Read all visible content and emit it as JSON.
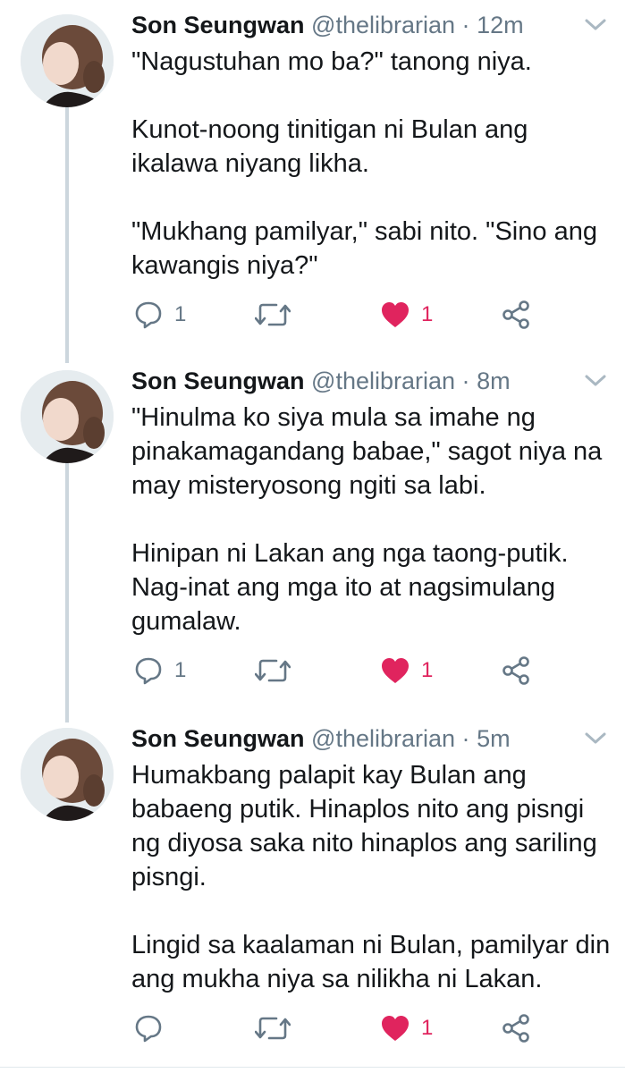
{
  "thread": [
    {
      "author_name": "Son Seungwan",
      "handle": "@thelibrarian",
      "separator": "·",
      "time": "12m",
      "paragraphs": [
        "\"Nagustuhan mo ba?\" tanong niya.",
        "Kunot-noong tinitigan ni Bulan ang ikalawa niyang likha.",
        "\"Mukhang pamilyar,\" sabi nito. \"Sino ang kawangis niya?\""
      ],
      "reply_count": "1",
      "retweet_count": "",
      "like_count": "1",
      "liked": true
    },
    {
      "author_name": "Son Seungwan",
      "handle": "@thelibrarian",
      "separator": "·",
      "time": "8m",
      "paragraphs": [
        "\"Hinulma ko siya mula sa imahe ng pinakamagandang babae,\" sagot niya na may misteryosong ngiti sa labi.",
        "Hinipan ni Lakan ang nga taong-putik. Nag-inat ang mga ito at nagsimulang gumalaw."
      ],
      "reply_count": "1",
      "retweet_count": "",
      "like_count": "1",
      "liked": true
    },
    {
      "author_name": "Son Seungwan",
      "handle": "@thelibrarian",
      "separator": "·",
      "time": "5m",
      "paragraphs": [
        "Humakbang palapit kay Bulan ang babaeng putik. Hinaplos nito ang pisngi ng diyosa saka nito hinaplos ang sariling pisngi.",
        "Lingid sa kaalaman ni Bulan, pamilyar din ang mukha niya sa nilikha ni Lakan."
      ],
      "reply_count": "",
      "retweet_count": "",
      "like_count": "1",
      "liked": true
    }
  ],
  "icons": {
    "reply": "reply-icon",
    "retweet": "retweet-icon",
    "like": "heart-icon",
    "share": "share-icon",
    "more": "chevron-down-icon",
    "avatar": "avatar"
  },
  "colors": {
    "text": "#14171a",
    "secondary": "#657786",
    "like": "#e0245e",
    "thread_line": "#ccd6dd"
  }
}
